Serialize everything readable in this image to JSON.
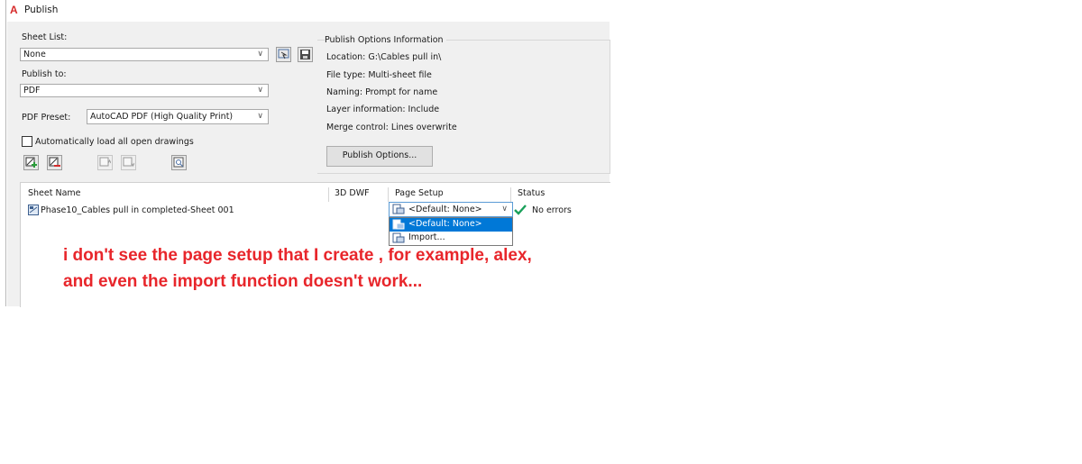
{
  "window": {
    "app_logo": "A",
    "title": "Publish"
  },
  "sheet_list": {
    "label": "Sheet List:",
    "value": "None"
  },
  "publish_to": {
    "label": "Publish to:",
    "value": "PDF"
  },
  "pdf_preset": {
    "label": "PDF Preset:",
    "value": "AutoCAD PDF (High Quality Print)"
  },
  "auto_load": {
    "label": "Automatically load all open drawings",
    "checked": false
  },
  "options_info": {
    "title": "Publish Options Information",
    "location": "Location: G:\\Cables pull in\\",
    "file_type": "File type: Multi-sheet file",
    "naming": "Naming: Prompt for name",
    "layer_info": "Layer information: Include",
    "merge_control": "Merge control: Lines overwrite",
    "button_label": "Publish Options..."
  },
  "table": {
    "columns": [
      "Sheet Name",
      "3D DWF",
      "Page Setup",
      "Status"
    ],
    "rows": [
      {
        "sheet_name": "Phase10_Cables pull in completed-Sheet 001",
        "dwf3d": "",
        "page_setup": "<Default: None>",
        "status": "No errors"
      }
    ]
  },
  "page_setup_dropdown": {
    "options": [
      "<Default: None>",
      "Import..."
    ],
    "selected_index": 0
  },
  "annotation": {
    "line1": "i don't see the page setup that I create , for example, alex,",
    "line2": "and even the import function doesn't work..."
  },
  "colors": {
    "logo": "#d62a2a",
    "annotation": "#e8262b",
    "selection": "#0078d7",
    "status_ok": "#19a05a"
  },
  "icons": [
    "autocad-logo-icon",
    "preview-icon",
    "save-icon",
    "add-sheet-icon",
    "remove-sheet-icon",
    "move-up-icon",
    "move-down-icon",
    "preview-sheet-icon",
    "layout-sheet-icon",
    "page-setup-icon",
    "checkmark-icon",
    "chevron-down-icon"
  ]
}
